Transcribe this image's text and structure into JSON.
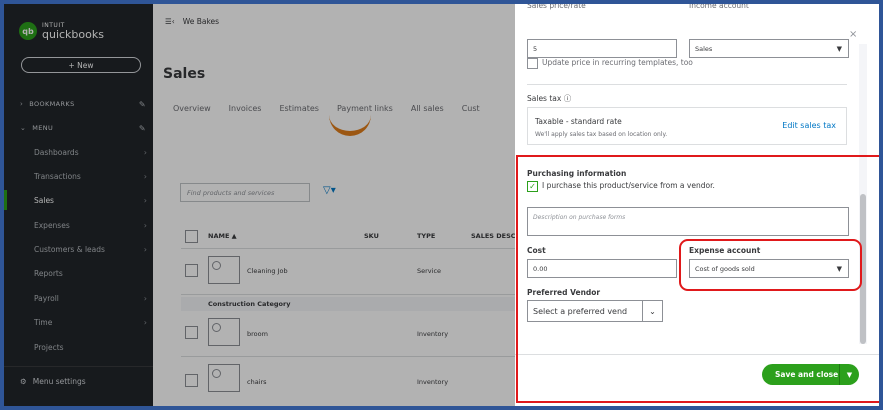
{
  "app": {
    "logo_brand": "INTUIT",
    "logo_product": "quickbooks",
    "new_button": "+ New",
    "company_name": "We Bakes"
  },
  "sidebar": {
    "bookmarks": "BOOKMARKS",
    "menu": "MENU",
    "items": [
      {
        "label": "Dashboards"
      },
      {
        "label": "Transactions"
      },
      {
        "label": "Sales"
      },
      {
        "label": "Expenses"
      },
      {
        "label": "Customers & leads"
      },
      {
        "label": "Reports"
      },
      {
        "label": "Payroll"
      },
      {
        "label": "Time"
      },
      {
        "label": "Projects"
      }
    ],
    "menu_settings": "Menu settings"
  },
  "main": {
    "title": "Sales",
    "tabs": [
      "Overview",
      "Invoices",
      "Estimates",
      "Payment links",
      "All sales",
      "Cust"
    ],
    "search_placeholder": "Find products and services",
    "columns": [
      "NAME ▲",
      "SKU",
      "TYPE",
      "SALES DESC"
    ],
    "rows": [
      {
        "name": "Cleaning Job",
        "type": "Service"
      },
      {
        "category": "Construction Category"
      },
      {
        "name": "broom",
        "type": "Inventory"
      },
      {
        "name": "chairs",
        "type": "Inventory"
      }
    ]
  },
  "drawer": {
    "sales_price_label": "Sales price/rate",
    "income_account_label": "Income account",
    "sales_price_value": "5",
    "income_account_value": "Sales",
    "update_price_label": "Update price in recurring templates, too",
    "sales_tax_label": "Sales tax",
    "tax_title": "Taxable - standard rate",
    "tax_subtitle": "We'll apply sales tax based on location only.",
    "tax_link": "Edit sales tax",
    "purchasing_label": "Purchasing information",
    "purchase_checkbox_label": "I purchase this product/service from a vendor.",
    "purchase_desc_placeholder": "Description on purchase forms",
    "cost_label": "Cost",
    "cost_value": "0.00",
    "expense_account_label": "Expense account",
    "expense_account_value": "Cost of goods sold",
    "vendor_label": "Preferred Vendor",
    "vendor_placeholder": "Select a preferred vend",
    "save_label": "Save and close"
  },
  "colors": {
    "brand_green": "#2ca01c",
    "link_blue": "#0077c5",
    "annotation_red": "#e0191b"
  }
}
